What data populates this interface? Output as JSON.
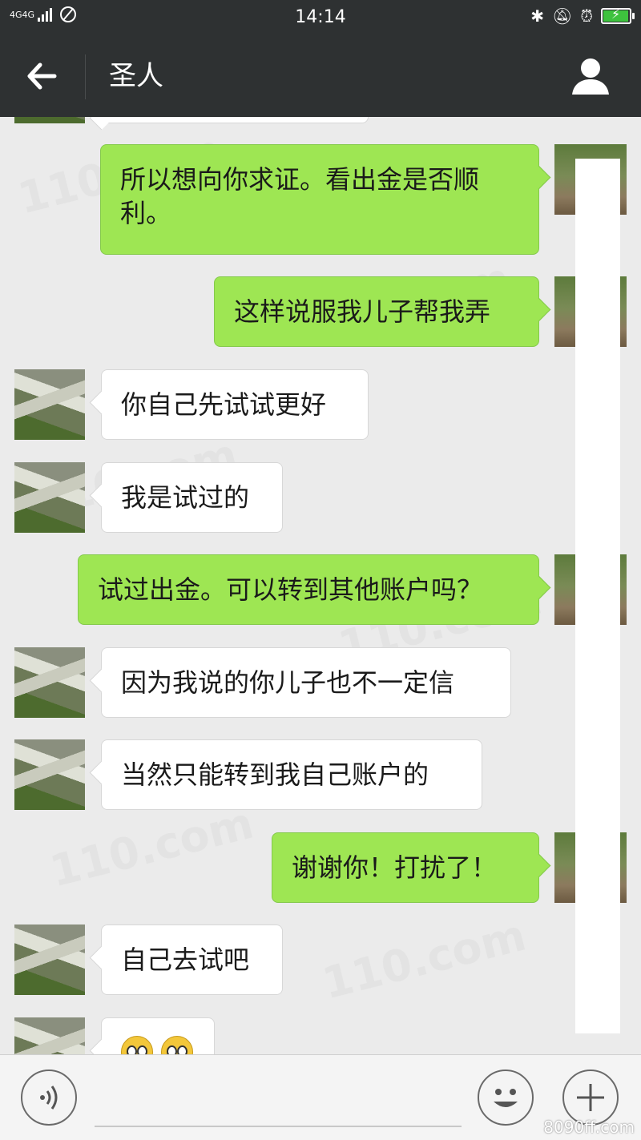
{
  "status_bar": {
    "network": "4G4G",
    "time": "14:14",
    "battery_level": 0.9,
    "icons": [
      "signal-icon",
      "no-sim-icon",
      "bluetooth-icon",
      "bell-muted-icon",
      "alarm-icon",
      "battery-icon"
    ]
  },
  "header": {
    "title": "圣人",
    "back_icon": "arrow-left-icon",
    "contact_icon": "person-icon"
  },
  "messages": [
    {
      "side": "right",
      "text": "所以想向你求证。看出金是否顺利。"
    },
    {
      "side": "right",
      "text": "这样说服我儿子帮我弄"
    },
    {
      "side": "left",
      "text": "你自己先试试更好"
    },
    {
      "side": "left",
      "text": "我是试过的"
    },
    {
      "side": "right",
      "text": "试过出金。可以转到其他账户吗？"
    },
    {
      "side": "left",
      "text": "因为我说的你儿子也不一定信"
    },
    {
      "side": "left",
      "text": "当然只能转到我自己账户的"
    },
    {
      "side": "right",
      "text": "谢谢你！打扰了！"
    },
    {
      "side": "left",
      "text": "自己去试吧"
    },
    {
      "side": "left",
      "text": "",
      "emoji": [
        "smiling-emoji",
        "smiling-emoji"
      ]
    }
  ],
  "watermark": "110.com",
  "corner_mark": "8090ff.com",
  "input_bar": {
    "voice_icon": "voice-icon",
    "emoji_icon": "smiley-icon",
    "plus_icon": "plus-icon"
  },
  "colors": {
    "header_bg": "#2e3132",
    "chat_bg": "#ebebeb",
    "bubble_outgoing": "#9ee653",
    "bubble_incoming": "#ffffff"
  }
}
